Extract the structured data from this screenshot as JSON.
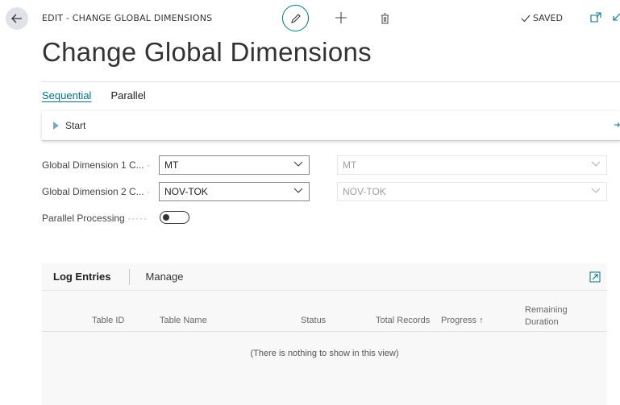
{
  "header": {
    "breadcrumb": "EDIT - CHANGE GLOBAL DIMENSIONS",
    "saved_label": "SAVED"
  },
  "page": {
    "title": "Change Global Dimensions"
  },
  "tabs": [
    {
      "label": "Sequential",
      "active": true
    },
    {
      "label": "Parallel",
      "active": false
    }
  ],
  "start": {
    "label": "Start"
  },
  "fields": {
    "dim1": {
      "label": "Global Dimension 1 C...",
      "value": "MT",
      "current_value": "MT"
    },
    "dim2": {
      "label": "Global Dimension 2 C...",
      "value": "NOV-TOK",
      "current_value": "NOV-TOK"
    },
    "parallel": {
      "label": "Parallel Processing",
      "on": false
    }
  },
  "log": {
    "title": "Log Entries",
    "manage_label": "Manage",
    "columns": {
      "table_id": "Table ID",
      "table_name": "Table Name",
      "status": "Status",
      "total_records": "Total Records",
      "progress": "Progress ↑",
      "remaining_1": "Remaining",
      "remaining_2": "Duration"
    },
    "empty_message": "(There is nothing to show in this view)"
  },
  "colors": {
    "accent": "#00718a",
    "back_button_bg": "#dfe3e8"
  },
  "icons": [
    "back-arrow-icon",
    "edit-pencil-icon",
    "plus-icon",
    "trash-icon",
    "checkmark-icon",
    "open-in-new-window-icon",
    "collapse-icon",
    "start-triangle-icon",
    "pin-icon",
    "chevron-down-icon",
    "expand-icon"
  ]
}
